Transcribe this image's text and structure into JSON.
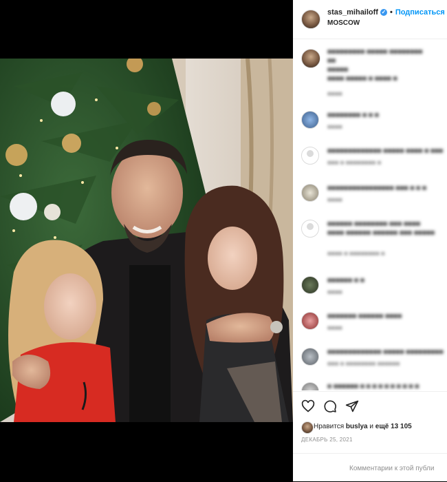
{
  "header": {
    "username": "stas_mihailoff",
    "verified_mark": "✓",
    "separator": "•",
    "follow_label": "Подписаться",
    "location": "MOSCOW"
  },
  "actions": {
    "like_icon": "heart-icon",
    "comment_icon": "comment-icon",
    "share_icon": "share-icon"
  },
  "likes": {
    "prefix": "Нравится",
    "user": "buslya",
    "middle": "и",
    "rest": "ещё 13 105"
  },
  "date": "ДЕКАБРЬ 25, 2021",
  "add_comment": {
    "placeholder": "Комментарии к этой публи"
  },
  "colors": {
    "accent": "#0095f6",
    "verified": "#3897f0",
    "meta": "#8e8e8e"
  }
}
